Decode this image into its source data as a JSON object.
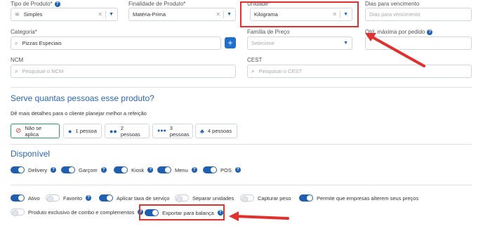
{
  "colors": {
    "accent": "#1f5fb0",
    "annotation": "#e0312f",
    "selected_chip": "#2e9a6a"
  },
  "fields": {
    "tipo_produto": {
      "label": "Tipo de Produto*",
      "value": "Simples",
      "icon": "layers-icon"
    },
    "finalidade": {
      "label": "Finalidade de Produto*",
      "value": "Matéria-Prima"
    },
    "unidade": {
      "label": "Unidade*",
      "value": "Kilograma"
    },
    "dias_vencimento": {
      "label": "Dias para vencimento",
      "placeholder": "Dias para vencimento"
    },
    "categoria": {
      "label": "Categoria*",
      "value": "Pizzas Especiais"
    },
    "familia_preco": {
      "label": "Família de Preço",
      "placeholder": "Selecione"
    },
    "qtd_maxima": {
      "label": "Qtd. máxima por pedido"
    },
    "ncm": {
      "label": "NCM",
      "placeholder": "Pesquisar o NCM"
    },
    "cest": {
      "label": "CEST",
      "placeholder": "Pesquisar o CEST"
    }
  },
  "serves": {
    "title": "Serve quantas pessoas esse produto?",
    "subtitle": "Dê mais detalhes para o cliente planejar melhor a refeição",
    "options": [
      {
        "label": "Não se aplica",
        "icon": "no-entry-icon",
        "selected": true
      },
      {
        "label": "1 pessoa",
        "icon": "person-icon"
      },
      {
        "label": "2 pessoas",
        "icon": "two-persons-icon"
      },
      {
        "label": "3 pessoas",
        "icon": "three-persons-icon"
      },
      {
        "label": "4 pessoas",
        "icon": "four-persons-icon"
      }
    ]
  },
  "disponivel": {
    "title": "Disponível",
    "toggles": [
      {
        "label": "Delivery",
        "on": true
      },
      {
        "label": "Garçom",
        "on": true
      },
      {
        "label": "Kiosk",
        "on": true
      },
      {
        "label": "Menu",
        "on": true
      },
      {
        "label": "POS",
        "on": true
      }
    ]
  },
  "flags": [
    {
      "label": "Ativo",
      "on": true
    },
    {
      "label": "Favorito",
      "on": false
    },
    {
      "label": "Aplicar taxa de serviço",
      "on": true
    },
    {
      "label": "Separar unidades",
      "on": false
    },
    {
      "label": "Capturar peso",
      "on": false
    },
    {
      "label": "Permite que empresas alterem seus preços",
      "on": true
    },
    {
      "label": "Produto exclusivo de combo e complementos",
      "on": false
    },
    {
      "label": "Exportar para balança",
      "on": true
    }
  ]
}
